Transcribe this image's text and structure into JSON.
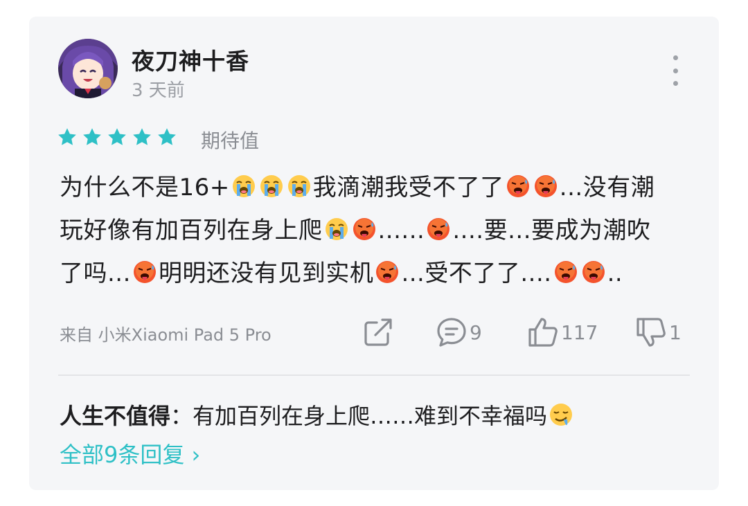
{
  "comment": {
    "username": "夜刀神十香",
    "time_ago": "3 天前",
    "rating": {
      "stars": 5,
      "max": 5,
      "label": "期待值"
    },
    "text_parts": {
      "l1a": "为什么不是16+",
      "l1b": "我滴潮我受不了了",
      "l1c": "...没有潮",
      "l2a": "玩好像有加百列在身上爬",
      "l2b": "......",
      "l2c": "....要...要成为潮吹",
      "l3a": "了吗...",
      "l3b": "明明还没有见到实机",
      "l3c": "...受不了了....",
      "l3d": ".."
    },
    "device": "来自 小米Xiaomi Pad 5 Pro",
    "actions": {
      "comment_count": "9",
      "like_count": "117",
      "dislike_count": "1"
    }
  },
  "reply": {
    "author": "人生不值得",
    "separator": "：",
    "text": "有加百列在身上爬……难到不幸福吗",
    "all_replies_label": "全部9条回复 ›"
  },
  "colors": {
    "accent": "#2ec0c6",
    "card_bg": "#f5f6f8",
    "secondary_text": "#8a8d93"
  },
  "icons": {
    "emoji_crying": "loudly-crying-face",
    "emoji_hot": "hot-face",
    "emoji_drooling": "drooling-face"
  }
}
